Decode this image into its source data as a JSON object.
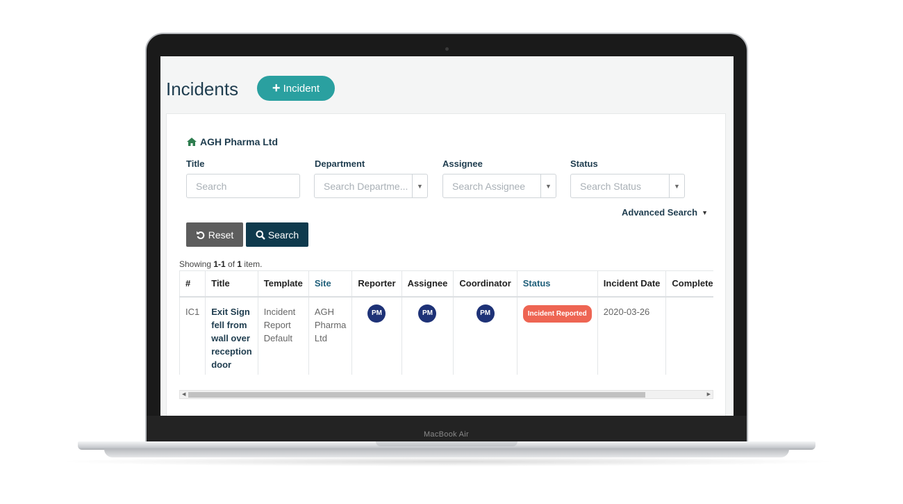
{
  "page": {
    "title": "Incidents",
    "add_button": "Incident"
  },
  "company": "AGH Pharma Ltd",
  "filters": [
    {
      "label": "Title",
      "placeholder": "Search"
    },
    {
      "label": "Department",
      "placeholder": "Search Departme..."
    },
    {
      "label": "Assignee",
      "placeholder": "Search Assignee"
    },
    {
      "label": "Status",
      "placeholder": "Search Status"
    }
  ],
  "advanced_search": "Advanced Search",
  "buttons": {
    "reset": "Reset",
    "search": "Search"
  },
  "summary": {
    "prefix": "Showing ",
    "range": "1-1",
    "mid": " of ",
    "total": "1",
    "suffix": " item."
  },
  "table": {
    "headers": [
      "#",
      "Title",
      "Template",
      "Site",
      "Reporter",
      "Assignee",
      "Coordinator",
      "Status",
      "Incident Date",
      "Completed"
    ],
    "rows": [
      {
        "id": "IC1",
        "title": "Exit Sign fell from wall over reception door",
        "template": "Incident Report Default",
        "site": "AGH Pharma Ltd",
        "reporter": "PM",
        "assignee": "PM",
        "coordinator": "PM",
        "status": "Incident Reported",
        "incident_date": "2020-03-26",
        "completed": ""
      }
    ]
  },
  "device": {
    "brand": "MacBook Air"
  },
  "colors": {
    "accent": "#2aa0a0",
    "primary_dark": "#0f3a4d",
    "status_badge": "#ee6553",
    "avatar": "#1e3277"
  }
}
